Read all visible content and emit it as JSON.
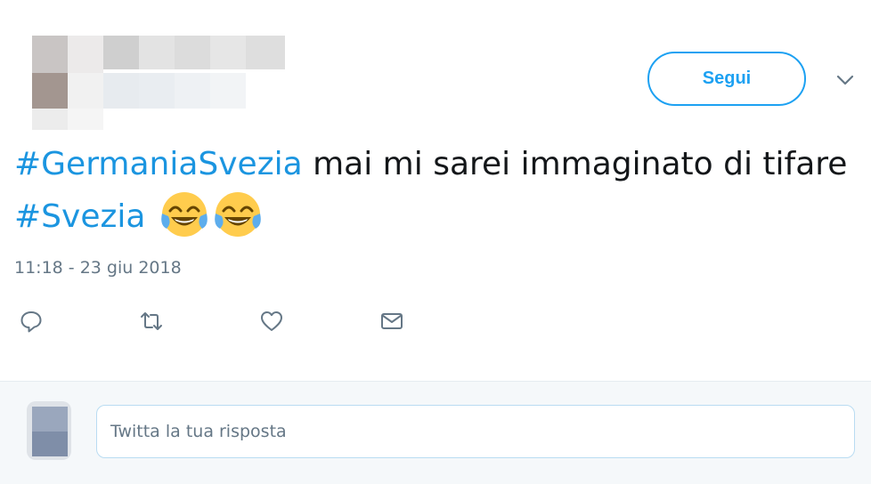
{
  "follow_button": {
    "label": "Segui"
  },
  "tweet": {
    "hashtag_1": "#GermaniaSvezia",
    "text_1": " mai mi sarei immaginato di tifare ",
    "hashtag_2": "#Svezia",
    "emoji": "face-with-tears-of-joy x2",
    "timestamp": "11:18 - 23 giu 2018"
  },
  "actions": {
    "reply_icon": "reply-icon",
    "retweet_icon": "retweet-icon",
    "like_icon": "heart-icon",
    "dm_icon": "envelope-icon"
  },
  "reply": {
    "placeholder": "Twitta la tua risposta"
  },
  "colors": {
    "accent": "#1da1f2",
    "hashtag": "#1b95e0",
    "muted": "#657786",
    "text": "#14171a"
  }
}
